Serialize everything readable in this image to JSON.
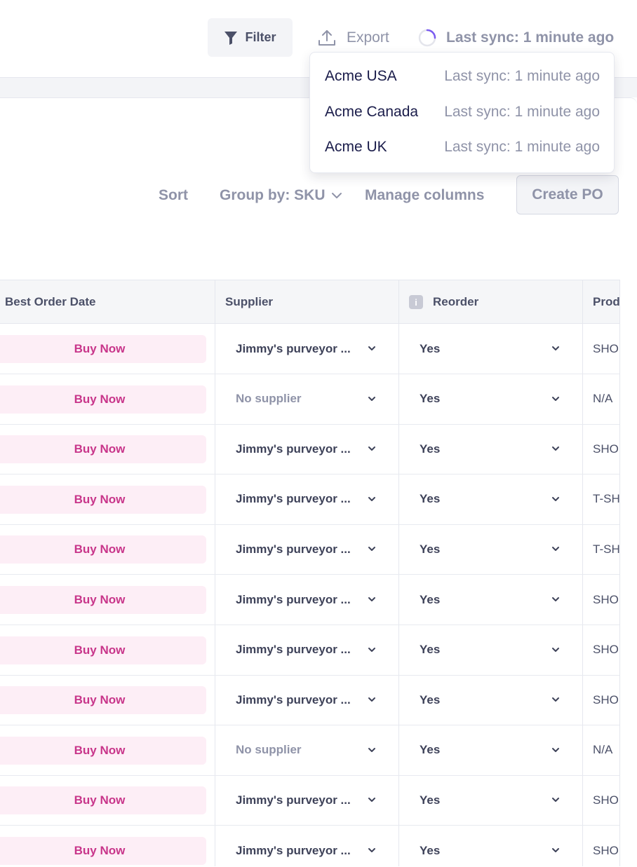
{
  "topbar": {
    "filter_label": "Filter",
    "export_label": "Export",
    "sync_label": "Last sync: 1 minute ago"
  },
  "sync_dropdown": [
    {
      "name": "Acme USA",
      "sync": "Last sync: 1 minute ago"
    },
    {
      "name": "Acme Canada",
      "sync": "Last sync: 1 minute ago"
    },
    {
      "name": "Acme UK",
      "sync": "Last sync: 1 minute ago"
    }
  ],
  "toolbar": {
    "sort_label": "Sort",
    "group_by_label": "Group by: SKU",
    "manage_columns_label": "Manage columns",
    "create_po_label": "Create PO"
  },
  "table": {
    "headers": {
      "best_order_date": "Best Order Date",
      "supplier": "Supplier",
      "reorder": "Reorder",
      "product": "Prod"
    },
    "rows": [
      {
        "action": "Buy Now",
        "supplier": "Jimmy's purveyor ...",
        "reorder": "Yes",
        "product": "SHO"
      },
      {
        "action": "Buy Now",
        "supplier": "No supplier",
        "reorder": "Yes",
        "product": "N/A"
      },
      {
        "action": "Buy Now",
        "supplier": "Jimmy's purveyor ...",
        "reorder": "Yes",
        "product": "SHO"
      },
      {
        "action": "Buy Now",
        "supplier": "Jimmy's purveyor ...",
        "reorder": "Yes",
        "product": "T-SH"
      },
      {
        "action": "Buy Now",
        "supplier": "Jimmy's purveyor ...",
        "reorder": "Yes",
        "product": "T-SH"
      },
      {
        "action": "Buy Now",
        "supplier": "Jimmy's purveyor ...",
        "reorder": "Yes",
        "product": "SHO"
      },
      {
        "action": "Buy Now",
        "supplier": "Jimmy's purveyor ...",
        "reorder": "Yes",
        "product": "SHO"
      },
      {
        "action": "Buy Now",
        "supplier": "Jimmy's purveyor ...",
        "reorder": "Yes",
        "product": "SHO"
      },
      {
        "action": "Buy Now",
        "supplier": "No supplier",
        "reorder": "Yes",
        "product": "N/A"
      },
      {
        "action": "Buy Now",
        "supplier": "Jimmy's purveyor ...",
        "reorder": "Yes",
        "product": "SHO"
      },
      {
        "action": "Buy Now",
        "supplier": "Jimmy's purveyor ...",
        "reorder": "Yes",
        "product": "SHO"
      }
    ]
  },
  "colors": {
    "accent_pink": "#c8358a",
    "pink_bg": "#fdeef6",
    "spinner": "#7b5cf0",
    "muted_text": "#8f93a8"
  },
  "icons": {
    "filter": "filter-icon",
    "export": "upload-icon",
    "sync": "spinner-icon",
    "chevron": "chevron-down-icon",
    "info": "info-icon"
  }
}
